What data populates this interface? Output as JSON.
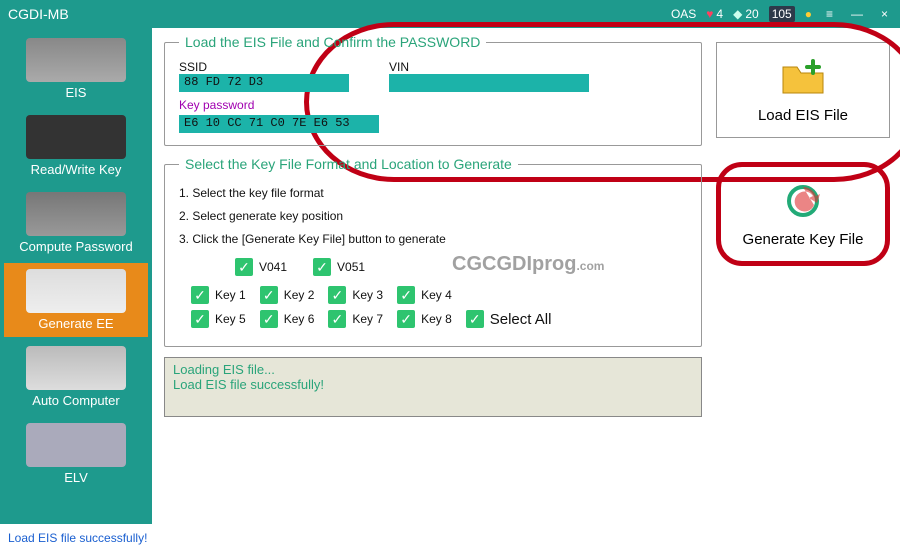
{
  "titlebar": {
    "title": "CGDI-MB",
    "oas": "OAS",
    "heart_count": "4",
    "diamond_count": "20",
    "calendar": "105"
  },
  "sidebar": {
    "items": [
      {
        "label": "EIS"
      },
      {
        "label": "Read/Write Key"
      },
      {
        "label": "Compute Password"
      },
      {
        "label": "Generate EE"
      },
      {
        "label": "Auto Computer"
      },
      {
        "label": "ELV"
      }
    ]
  },
  "load_eis": {
    "legend": "Load the EIS File and Confirm the PASSWORD",
    "ssid_label": "SSID",
    "ssid_value": "88 FD 72 D3",
    "vin_label": "VIN",
    "vin_value": "",
    "keypw_label": "Key password",
    "keypw_value": "E6 10 CC 71 C0 7E E6 53"
  },
  "select_fmt": {
    "legend": "Select the Key File Format and Location to Generate",
    "step1": "1. Select the key file format",
    "step2": "2. Select generate key position",
    "step3": "3. Click the [Generate Key File] button to generate",
    "fmt1": "V041",
    "fmt2": "V051",
    "keys": [
      "Key 1",
      "Key 2",
      "Key 3",
      "Key 4",
      "Key 5",
      "Key 6",
      "Key 7",
      "Key 8"
    ],
    "select_all": "Select All"
  },
  "log": {
    "line1": "Loading  EIS  file...",
    "line2": "Load  EIS  file  successfully!"
  },
  "right": {
    "load_btn": "Load EIS File",
    "gen_btn": "Generate Key File"
  },
  "status": "Load EIS file successfully!",
  "watermark": {
    "a": "CG",
    "b": "CGDIprog",
    "c": ".com"
  }
}
